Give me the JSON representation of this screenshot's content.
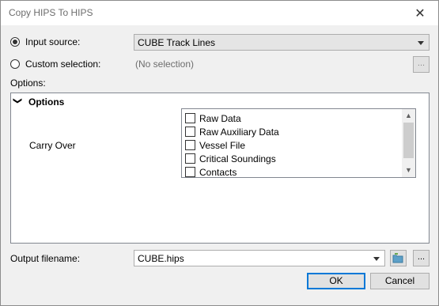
{
  "window": {
    "title": "Copy HIPS To HIPS",
    "close_glyph": "✕"
  },
  "input_source": {
    "label": "Input source:",
    "value": "CUBE Track Lines",
    "selected": true
  },
  "custom_selection": {
    "label": "Custom selection:",
    "value": "(No selection)",
    "button_label": "...",
    "selected": false
  },
  "options_label": "Options:",
  "options_panel": {
    "header": "Options",
    "expander_glyph": "❯",
    "carry_over_label": "Carry Over",
    "items": [
      {
        "label": "Raw Data",
        "checked": false
      },
      {
        "label": "Raw Auxiliary Data",
        "checked": false
      },
      {
        "label": "Vessel File",
        "checked": false
      },
      {
        "label": "Critical Soundings",
        "checked": false
      },
      {
        "label": "Contacts",
        "checked": false
      }
    ]
  },
  "output": {
    "label": "Output filename:",
    "value": "CUBE.hips",
    "browse_label": "..."
  },
  "buttons": {
    "ok": "OK",
    "cancel": "Cancel"
  }
}
